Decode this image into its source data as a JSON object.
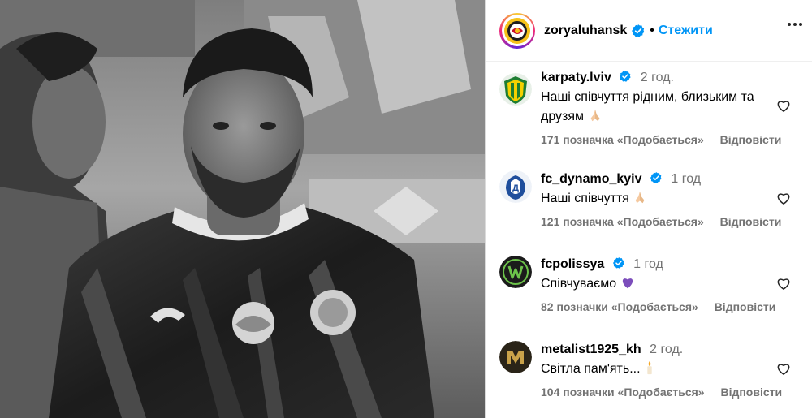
{
  "post": {
    "username": "zoryaluhansk",
    "follow_label": "Стежити",
    "separator": "•"
  },
  "comments": [
    {
      "username": "karpaty.lviv",
      "time": "2 год.",
      "text": "Наші співчуття рідним, близьким та друзям",
      "emoji": "praying-hands-icon",
      "likes": "171 позначка «Подобається»",
      "reply": "Відповісти"
    },
    {
      "username": "fc_dynamo_kyiv",
      "time": "1 год",
      "text": "Наші співчуття",
      "emoji": "praying-hands-icon",
      "likes": "121 позначка «Подобається»",
      "reply": "Відповісти"
    },
    {
      "username": "fcpolissya",
      "time": "1 год",
      "text": "Співчуваємо",
      "emoji": "purple-heart-icon",
      "likes": "82 позначки «Подобається»",
      "reply": "Відповісти"
    },
    {
      "username": "metalist1925_kh",
      "time": "2 год.",
      "text": "Світла пам'ять...",
      "emoji": "candle-icon",
      "likes": "104 позначки «Подобається»",
      "reply": "Відповісти"
    }
  ],
  "colors": {
    "accent": "#0095f6",
    "verified": "#0095f6",
    "muted": "#737373",
    "karpaty_green": "#1e7d32",
    "dynamo_blue": "#1f4e9c",
    "polissya_green": "#2e5d2c",
    "metalist_gold": "#c9a24a"
  }
}
